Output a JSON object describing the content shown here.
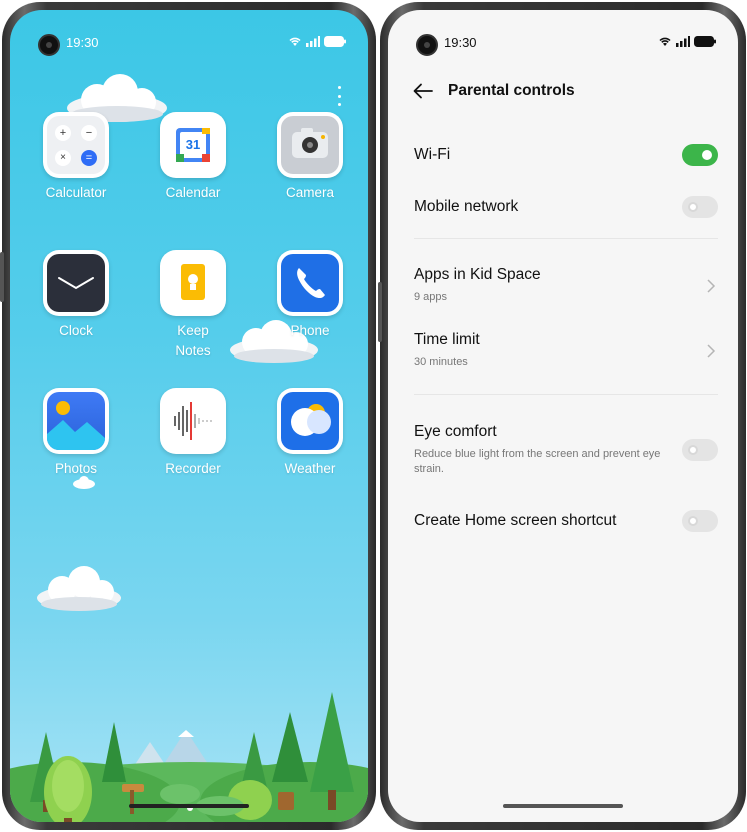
{
  "left_phone": {
    "status": {
      "time": "19:30"
    },
    "apps": [
      {
        "label": "Calculator",
        "icon": "calculator-icon"
      },
      {
        "label": "Calendar",
        "icon": "calendar-icon",
        "badge": "31"
      },
      {
        "label": "Camera",
        "icon": "camera-icon"
      },
      {
        "label": "Clock",
        "icon": "clock-icon"
      },
      {
        "label": "Keep\nNotes",
        "label_line1": "Keep",
        "label_line2": "Notes",
        "icon": "keep-notes-icon"
      },
      {
        "label": "Phone",
        "icon": "phone-icon"
      },
      {
        "label": "Photos",
        "icon": "photos-icon"
      },
      {
        "label": "Recorder",
        "icon": "recorder-icon"
      },
      {
        "label": "Weather",
        "icon": "weather-icon"
      }
    ],
    "calculator_keys": [
      "+",
      "−",
      "×",
      "="
    ]
  },
  "right_phone": {
    "status": {
      "time": "19:30"
    },
    "header": {
      "title": "Parental controls"
    },
    "settings": {
      "wifi": {
        "title": "Wi-Fi",
        "enabled": true
      },
      "mobile_network": {
        "title": "Mobile network",
        "enabled": false
      },
      "apps": {
        "title": "Apps in Kid Space",
        "subtitle": "9 apps"
      },
      "time_limit": {
        "title": "Time limit",
        "subtitle": "30 minutes"
      },
      "eye_comfort": {
        "title": "Eye comfort",
        "subtitle": "Reduce blue light from the screen and prevent eye strain.",
        "enabled": false
      },
      "shortcut": {
        "title": "Create Home screen shortcut",
        "enabled": false
      }
    }
  },
  "colors": {
    "sky": "#3cc7e6",
    "toggle_on": "#3cb54a",
    "toggle_off": "#e4e4e4"
  }
}
